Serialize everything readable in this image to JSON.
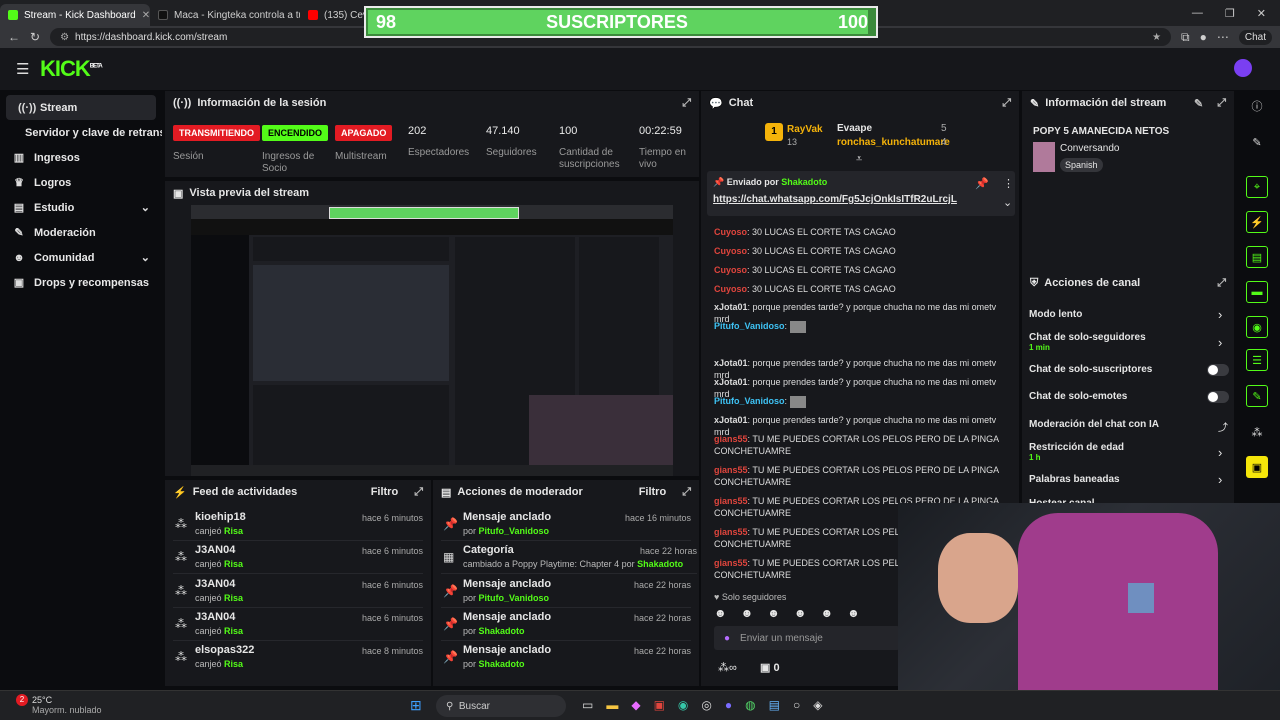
{
  "browser": {
    "tabs": [
      {
        "title": "Stream - Kick Dashboard",
        "color": "#53fc18"
      },
      {
        "title": "Maca - Kingteka controla a tu mu",
        "color": "#111111"
      },
      {
        "title": "(135) Cevich",
        "color": "#ff0000"
      }
    ],
    "url": "https://dashboard.kick.com/stream",
    "chat_label": "Chat"
  },
  "overlay": {
    "left": "98",
    "label": "SUSCRIPTORES",
    "right": "100",
    "progress": 0.98
  },
  "app": {
    "logo": "KICK",
    "logo_tag": "BETA"
  },
  "sidebar": {
    "items": [
      {
        "label": "Stream",
        "icon": "broadcast-icon"
      },
      {
        "label": "Servidor y clave de retransmisión",
        "icon": ""
      },
      {
        "label": "Ingresos",
        "icon": "chart-icon"
      },
      {
        "label": "Logros",
        "icon": "trophy-icon"
      },
      {
        "label": "Estudio",
        "icon": "brush-icon"
      },
      {
        "label": "Moderación",
        "icon": "wrench-icon"
      },
      {
        "label": "Comunidad",
        "icon": "people-icon"
      },
      {
        "label": "Drops y recompensas",
        "icon": "gift-icon"
      }
    ]
  },
  "session": {
    "title": "Información de la sesión",
    "stats": [
      {
        "badge": "TRANSMITIENDO",
        "label": "Sesión"
      },
      {
        "badge": "ENCENDIDO",
        "label": "Ingresos de Socio"
      },
      {
        "badge": "APAGADO",
        "label": "Multistream"
      },
      {
        "value": "202",
        "label": "Espectadores"
      },
      {
        "value": "47.140",
        "label": "Seguidores"
      },
      {
        "value": "100",
        "label": "Cantidad de suscripciones"
      },
      {
        "value": "00:22:59",
        "label": "Tiempo en vivo"
      }
    ]
  },
  "preview": {
    "title": "Vista previa del stream"
  },
  "feed": {
    "title": "Feed de actividades",
    "filter": "Filtro",
    "items": [
      {
        "user": "kioehip18",
        "action": "canjeó",
        "reward": "Risa",
        "time": "hace 6 minutos"
      },
      {
        "user": "J3AN04",
        "action": "canjeó",
        "reward": "Risa",
        "time": "hace 6 minutos"
      },
      {
        "user": "J3AN04",
        "action": "canjeó",
        "reward": "Risa",
        "time": "hace 6 minutos"
      },
      {
        "user": "J3AN04",
        "action": "canjeó",
        "reward": "Risa",
        "time": "hace 6 minutos"
      },
      {
        "user": "elsopas322",
        "action": "canjeó",
        "reward": "Risa",
        "time": "hace 8 minutos"
      }
    ]
  },
  "modactions": {
    "title": "Acciones de moderador",
    "filter": "Filtro",
    "items": [
      {
        "title": "Mensaje anclado",
        "by": "por",
        "user": "Pitufo_Vanidoso",
        "extra": "",
        "time": "hace 16 minutos"
      },
      {
        "title": "Categoría",
        "by": "cambiado a Poppy Playtime: Chapter 4 por",
        "user": "Shakadoto",
        "extra": "",
        "time": "hace 22 horas"
      },
      {
        "title": "Mensaje anclado",
        "by": "por",
        "user": "Pitufo_Vanidoso",
        "extra": "",
        "time": "hace 22 horas"
      },
      {
        "title": "Mensaje anclado",
        "by": "por",
        "user": "Shakadoto",
        "extra": "",
        "time": "hace 22 horas"
      },
      {
        "title": "Mensaje anclado",
        "by": "por",
        "user": "Shakadoto",
        "extra": "",
        "time": "hace 22 horas"
      }
    ]
  },
  "chat": {
    "title": "Chat",
    "leaders": [
      {
        "name": "RayVak",
        "count": "13"
      },
      {
        "name": "Evaape",
        "count": "5"
      },
      {
        "name": "ronchas_kunchatumare",
        "count": "4"
      }
    ],
    "pinned": {
      "label": "Enviado por",
      "user": "Shakadoto",
      "link": "https://chat.whatsapp.com/Fg5JcjOnkIsITfR2uLrcjL"
    },
    "messages": [
      {
        "user": "Cuyoso",
        "color": "#e0453d",
        "text": ": 30 LUCAS EL CORTE TAS CAGAO"
      },
      {
        "user": "Cuyoso",
        "color": "#e0453d",
        "text": ": 30 LUCAS EL CORTE TAS CAGAO"
      },
      {
        "user": "Cuyoso",
        "color": "#e0453d",
        "text": ": 30 LUCAS EL CORTE TAS CAGAO"
      },
      {
        "user": "Cuyoso",
        "color": "#e0453d",
        "text": ": 30 LUCAS EL CORTE TAS CAGAO"
      },
      {
        "user": "xJota01",
        "color": "#e6e6e6",
        "text": ": porque prendes tarde? y porque chucha no me das mi ometv mrd"
      },
      {
        "user": "Pitufo_Vanidoso",
        "color": "#3ec3f5",
        "text": ":"
      },
      {
        "user": "xJota01",
        "color": "#e6e6e6",
        "text": ": porque prendes tarde? y porque chucha no me das mi ometv mrd"
      },
      {
        "user": "xJota01",
        "color": "#e6e6e6",
        "text": ": porque prendes tarde? y porque chucha no me das mi ometv mrd"
      },
      {
        "user": "xJota01",
        "color": "#e6e6e6",
        "text": ": porque prendes tarde? y porque chucha no me das mi ometv mrd"
      },
      {
        "user": "Pitufo_Vanidoso",
        "color": "#3ec3f5",
        "text": ":"
      },
      {
        "user": "xJota01",
        "color": "#e6e6e6",
        "text": ": porque prendes tarde? y porque chucha no me das mi ometv mrd"
      },
      {
        "user": "gians55",
        "color": "#e0453d",
        "text": ": TU ME PUEDES CORTAR LOS PELOS PERO DE LA PINGA CONCHETUAMRE"
      },
      {
        "user": "gians55",
        "color": "#e0453d",
        "text": ": TU ME PUEDES CORTAR LOS PELOS PERO DE LA PINGA CONCHETUAMRE"
      },
      {
        "user": "gians55",
        "color": "#e0453d",
        "text": ": TU ME PUEDES CORTAR LOS PELOS PERO DE LA PINGA CONCHETUAMRE"
      },
      {
        "user": "gians55",
        "color": "#e0453d",
        "text": ": TU ME PUEDES CORTAR LOS PELOS PERO DE LA PINGA CONCHETUAMRE"
      },
      {
        "user": "gians55",
        "color": "#e0453d",
        "text": ": TU ME PUEDES CORTAR LOS PELOS PERO DE LA PINGA CONCHETUAMRE"
      }
    ],
    "mode": "Solo seguidores",
    "input_placeholder": "Enviar un mensaje",
    "points": "0"
  },
  "streaminfo": {
    "title": "Información del stream",
    "stream_title": "POPY 5 AMANECIDA NETOS",
    "category": "Conversando",
    "language": "Spanish"
  },
  "channelactions": {
    "title": "Acciones de canal",
    "items": [
      {
        "label": "Modo lento",
        "sub": "",
        "control": "chevron"
      },
      {
        "label": "Chat de solo-seguidores",
        "sub": "1 min",
        "control": "chevron"
      },
      {
        "label": "Chat de solo-suscriptores",
        "sub": "",
        "control": "toggle"
      },
      {
        "label": "Chat de solo-emotes",
        "sub": "",
        "control": "toggle"
      },
      {
        "label": "Moderación del chat con IA",
        "sub": "",
        "control": "external"
      },
      {
        "label": "Restricción de edad",
        "sub": "1 h",
        "control": "chevron"
      },
      {
        "label": "Palabras baneadas",
        "sub": "",
        "control": "chevron"
      },
      {
        "label": "Hostear canal",
        "sub": "",
        "control": ""
      }
    ]
  },
  "taskbar": {
    "weather_temp": "25°C",
    "weather_desc": "Mayorm. nublado",
    "notif_count": "2",
    "search": "Buscar"
  },
  "colors": {
    "accent": "#53fc18",
    "panel": "#17181c",
    "bg": "#0b0c0f"
  }
}
